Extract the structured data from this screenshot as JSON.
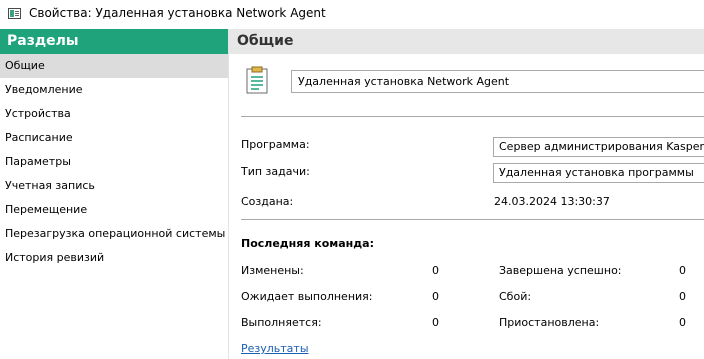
{
  "window": {
    "title": "Свойства: Удаленная установка Network Agent",
    "icon": "window-app-icon"
  },
  "sidebar": {
    "header": "Разделы",
    "items": [
      {
        "label": "Общие",
        "active": true
      },
      {
        "label": "Уведомление"
      },
      {
        "label": "Устройства"
      },
      {
        "label": "Расписание"
      },
      {
        "label": "Параметры"
      },
      {
        "label": "Учетная запись"
      },
      {
        "label": "Перемещение"
      },
      {
        "label": "Перезагрузка операционной системы"
      },
      {
        "label": "История ревизий"
      }
    ]
  },
  "main": {
    "header": "Общие",
    "task_icon": "clipboard-icon",
    "task_name": "Удаленная установка Network Agent",
    "program_label": "Программа:",
    "program_value": "Сервер администрирования Kaspersky Se",
    "task_type_label": "Тип задачи:",
    "task_type_value": "Удаленная установка программы",
    "created_label": "Создана:",
    "created_value": "24.03.2024 13:30:37",
    "last_command_title": "Последняя команда:",
    "stats_left": [
      {
        "label": "Изменены:",
        "value": "0"
      },
      {
        "label": "Ожидает выполнения:",
        "value": "0"
      },
      {
        "label": "Выполняется:",
        "value": "0"
      }
    ],
    "stats_right": [
      {
        "label": "Завершена успешно:",
        "value": "0"
      },
      {
        "label": "Сбой:",
        "value": "0"
      },
      {
        "label": "Приостановлена:",
        "value": "0"
      }
    ],
    "results_link": "Результаты"
  }
}
